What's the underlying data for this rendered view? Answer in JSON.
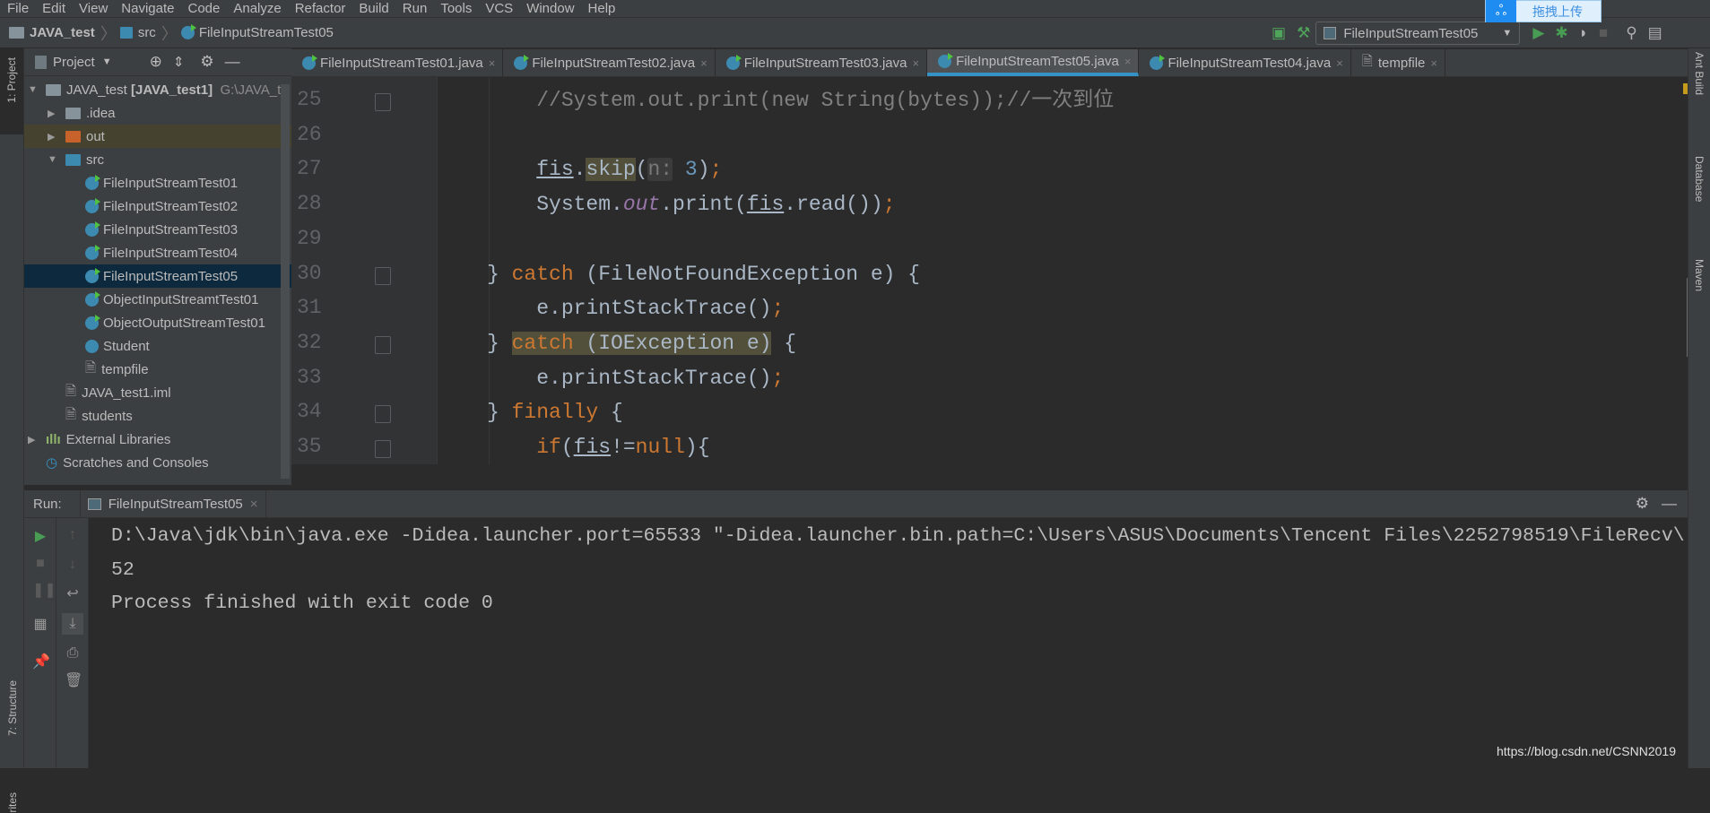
{
  "menu": [
    "File",
    "Edit",
    "View",
    "Navigate",
    "Code",
    "Analyze",
    "Refactor",
    "Build",
    "Run",
    "Tools",
    "VCS",
    "Window",
    "Help"
  ],
  "breadcrumb": {
    "project": "JAVA_test",
    "folder": "src",
    "file": "FileInputStreamTest05"
  },
  "run_config": "FileInputStreamTest05",
  "upload_popup": "拖拽上传",
  "left_strip": {
    "project": "1: Project",
    "structure": "7: Structure",
    "favorites": "rites"
  },
  "right_strip": {
    "ant": "Ant Build",
    "database": "Database",
    "maven": "Maven"
  },
  "project_panel": {
    "title": "Project",
    "root": {
      "name": "JAVA_test",
      "module": "[JAVA_test1]",
      "path": "G:\\JAVA_t"
    },
    "items": [
      {
        "label": ".idea",
        "type": "folder",
        "depth": 1,
        "expand": "right"
      },
      {
        "label": "out",
        "type": "out-folder",
        "depth": 1,
        "expand": "right"
      },
      {
        "label": "src",
        "type": "src-folder",
        "depth": 1,
        "expand": "down"
      },
      {
        "label": "FileInputStreamTest01",
        "type": "class-run",
        "depth": 2
      },
      {
        "label": "FileInputStreamTest02",
        "type": "class-run",
        "depth": 2
      },
      {
        "label": "FileInputStreamTest03",
        "type": "class-run",
        "depth": 2
      },
      {
        "label": "FileInputStreamTest04",
        "type": "class-run",
        "depth": 2
      },
      {
        "label": "FileInputStreamTest05",
        "type": "class-run",
        "depth": 2,
        "selected": true
      },
      {
        "label": "ObjectInputStreamtTest01",
        "type": "class-run",
        "depth": 2
      },
      {
        "label": "ObjectOutputStreamTest01",
        "type": "class-run",
        "depth": 2
      },
      {
        "label": "Student",
        "type": "class",
        "depth": 2
      },
      {
        "label": "tempfile",
        "type": "file",
        "depth": 2
      },
      {
        "label": "JAVA_test1.iml",
        "type": "file",
        "depth": 1
      },
      {
        "label": "students",
        "type": "file",
        "depth": 1
      },
      {
        "label": "External Libraries",
        "type": "libs",
        "depth": 0,
        "expand": "right"
      },
      {
        "label": "Scratches and Consoles",
        "type": "scratch",
        "depth": 0
      }
    ]
  },
  "tabs": [
    {
      "label": "FileInputStreamTest01.java"
    },
    {
      "label": "FileInputStreamTest02.java"
    },
    {
      "label": "FileInputStreamTest03.java"
    },
    {
      "label": "FileInputStreamTest05.java",
      "active": true
    },
    {
      "label": "FileInputStreamTest04.java"
    },
    {
      "label": "tempfile",
      "file": true
    }
  ],
  "code": [
    {
      "n": "25",
      "fold": true,
      "tokens": [
        {
          "t": "    //System.out.print(new String(bytes));//一次到位",
          "s": "cm"
        }
      ]
    },
    {
      "n": "26",
      "tokens": []
    },
    {
      "n": "27",
      "tokens": [
        {
          "t": "    "
        },
        {
          "t": "fis",
          "s": "u"
        },
        {
          "t": "."
        },
        {
          "t": "skip",
          "s": "hl"
        },
        {
          "t": "("
        },
        {
          "t": "n:",
          "s": "hint"
        },
        {
          "t": " 3",
          "s": "num"
        },
        {
          "t": ")"
        },
        {
          "t": ";",
          "s": "semi"
        }
      ]
    },
    {
      "n": "28",
      "tokens": [
        {
          "t": "    System."
        },
        {
          "t": "out",
          "s": "sf"
        },
        {
          "t": ".print("
        },
        {
          "t": "fis",
          "s": "u"
        },
        {
          "t": ".read())"
        },
        {
          "t": ";",
          "s": "semi"
        }
      ]
    },
    {
      "n": "29",
      "tokens": []
    },
    {
      "n": "30",
      "fold": true,
      "tokens": [
        {
          "t": "} "
        },
        {
          "t": "catch",
          "s": "kw"
        },
        {
          "t": " (FileNotFoundException e) {"
        }
      ]
    },
    {
      "n": "31",
      "tokens": [
        {
          "t": "    e.printStackTrace()"
        },
        {
          "t": ";",
          "s": "semi"
        }
      ]
    },
    {
      "n": "32",
      "fold": true,
      "tokens": [
        {
          "t": "} "
        },
        {
          "t": "catch",
          "s": "kw hl"
        },
        {
          "t": " (IOException e)",
          "s": "hl"
        },
        {
          "t": " {"
        }
      ]
    },
    {
      "n": "33",
      "tokens": [
        {
          "t": "    e.printStackTrace()"
        },
        {
          "t": ";",
          "s": "semi"
        }
      ]
    },
    {
      "n": "34",
      "fold": true,
      "tokens": [
        {
          "t": "} "
        },
        {
          "t": "finally",
          "s": "kw"
        },
        {
          "t": " {"
        }
      ]
    },
    {
      "n": "35",
      "fold": true,
      "tokens": [
        {
          "t": "    "
        },
        {
          "t": "if",
          "s": "kw"
        },
        {
          "t": "("
        },
        {
          "t": "fis",
          "s": "u"
        },
        {
          "t": "!="
        },
        {
          "t": "null",
          "s": "kw"
        },
        {
          "t": "){"
        }
      ]
    }
  ],
  "run": {
    "label": "Run:",
    "tab": "FileInputStreamTest05",
    "output": [
      "D:\\Java\\jdk\\bin\\java.exe -Didea.launcher.port=65533 \"-Didea.launcher.bin.path=C:\\Users\\ASUS\\Documents\\Tencent Files\\2252798519\\FileRecv\\",
      "52",
      "Process finished with exit code 0"
    ]
  },
  "watermark": "https://blog.csdn.net/CSNN2019",
  "colors": {
    "keyword": "#cc7832",
    "comment": "#808080",
    "number": "#6897bb",
    "static_field": "#9876aa",
    "text": "#a9b7c6",
    "selection": "#0d293e",
    "run_green": "#499c54",
    "tab_accent": "#3592c4"
  }
}
